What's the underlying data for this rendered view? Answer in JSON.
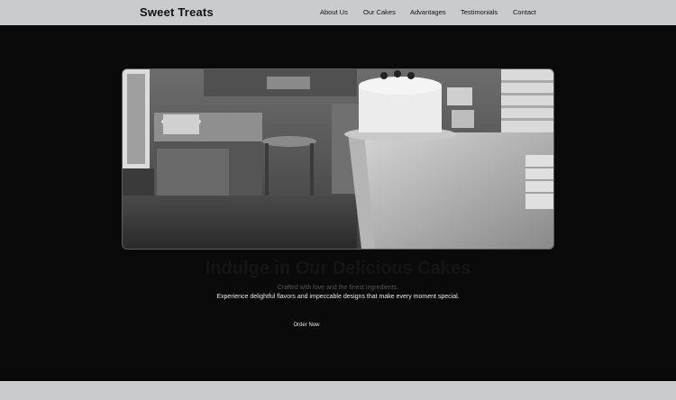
{
  "header": {
    "brand": "Sweet Treats",
    "nav": [
      "About Us",
      "Our Cakes",
      "Advantages",
      "Testimonials",
      "Contact"
    ]
  },
  "hero": {
    "image_icon": "bakery-kitchen-image",
    "headline": "Indulge in Our Delicious Cakes",
    "subtitle": "Crafted with love and the finest ingredients.",
    "description": "Experience delightful flavors and impeccable designs that make every moment special.",
    "cta": "Order Now"
  },
  "colors": {
    "header_bg": "#c9cbcd",
    "page_bg": "#0a0a0b",
    "footer_bg": "#c9cbcd"
  }
}
